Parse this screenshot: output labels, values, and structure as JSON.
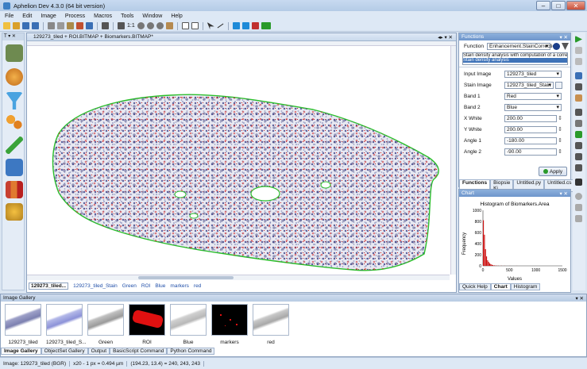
{
  "window": {
    "title": "Aphelion Dev 4.3.0 (64 bit version)"
  },
  "menu": [
    "File",
    "Edit",
    "Image",
    "Process",
    "Macros",
    "Tools",
    "Window",
    "Help"
  ],
  "toolbar": {
    "zoom_label": "1:1"
  },
  "document": {
    "title": "129273_tiled + ROI.BITMAP + Biomarkers.BITMAP*",
    "tabs": [
      "129273_tiled...",
      "129273_tiled_Stain",
      "Green",
      "ROI",
      "Blue",
      "markers",
      "red"
    ]
  },
  "functions_panel": {
    "header": "Functions",
    "function_label": "Function",
    "function_value": "Enhancement.StainCorrection",
    "description_line1": "Stain density analysis with computation of a corrected ir",
    "description_line2": "Stain density analysis",
    "params": [
      {
        "label": "Input Image",
        "value": "129273_tiled",
        "kind": "select"
      },
      {
        "label": "Stain Image",
        "value": "129273_tiled_Stain",
        "kind": "select"
      },
      {
        "label": "Band 1",
        "value": "Red",
        "kind": "select"
      },
      {
        "label": "Band 2",
        "value": "Blue",
        "kind": "select"
      },
      {
        "label": "X White",
        "value": "200.00",
        "kind": "spin"
      },
      {
        "label": "Y White",
        "value": "200.00",
        "kind": "spin"
      },
      {
        "label": "Angle 1",
        "value": "-180.00",
        "kind": "spin"
      },
      {
        "label": "Angle 2",
        "value": "-90.00",
        "kind": "spin"
      }
    ],
    "apply_label": "Apply",
    "tabs": [
      "Functions",
      "Biopsie Ki...",
      "Untitled.py",
      "Untitled.cs"
    ]
  },
  "chart_panel": {
    "header": "Chart",
    "tabs": [
      "Quick Help",
      "Chart",
      "Histogram"
    ],
    "chart_data": {
      "type": "bar",
      "title": "Histogram of Biomarkers.Area",
      "xlabel": "Values",
      "ylabel": "Frequency",
      "xlim": [
        0,
        1500
      ],
      "ylim": [
        0,
        1000
      ],
      "xticks": [
        "0",
        "500",
        "1000",
        "1500"
      ],
      "yticks": [
        "0",
        "200",
        "400",
        "600",
        "800",
        "1000"
      ],
      "bins": [
        {
          "x": 20,
          "y": 820
        },
        {
          "x": 40,
          "y": 560
        },
        {
          "x": 60,
          "y": 300
        },
        {
          "x": 80,
          "y": 170
        },
        {
          "x": 100,
          "y": 100
        },
        {
          "x": 120,
          "y": 70
        },
        {
          "x": 140,
          "y": 45
        },
        {
          "x": 160,
          "y": 30
        },
        {
          "x": 180,
          "y": 20
        },
        {
          "x": 200,
          "y": 14
        },
        {
          "x": 230,
          "y": 9
        },
        {
          "x": 260,
          "y": 6
        },
        {
          "x": 300,
          "y": 4
        },
        {
          "x": 360,
          "y": 3
        },
        {
          "x": 420,
          "y": 2
        },
        {
          "x": 520,
          "y": 1
        },
        {
          "x": 650,
          "y": 1
        }
      ],
      "color": "#cc1010"
    }
  },
  "gallery": {
    "header": "Image Gallery",
    "items": [
      "129273_tiled",
      "129273_tiled_S...",
      "Green",
      "ROI",
      "Blue",
      "markers",
      "red"
    ],
    "tabs": [
      "Image Gallery",
      "ObjectSet Gallery",
      "Output",
      "BasicScript Command",
      "Python Command"
    ]
  },
  "status": {
    "image": "Image: 129273_tiled (BGR)",
    "scale": "x20 - 1 px = 0.494 µm",
    "coords": "(194.23, 13.4) = 240, 243, 243"
  },
  "colors": {
    "accent": "#3f73b8",
    "roi": "#2bbf2b",
    "marker": "#d21e1e"
  }
}
